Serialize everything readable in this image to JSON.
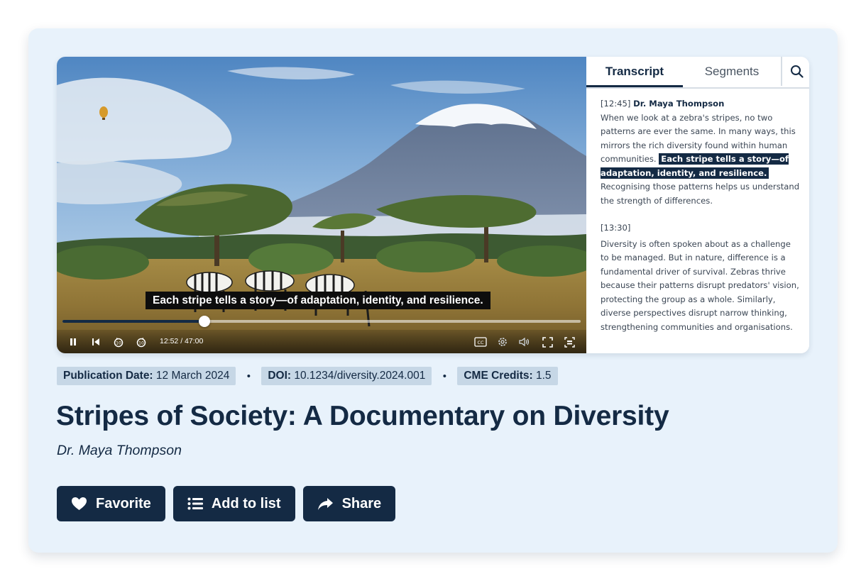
{
  "player": {
    "caption": "Each stripe tells a story—of adaptation, identity, and resilience.",
    "time": "12:52 / 47:00",
    "progress_fraction": 0.274,
    "controls": [
      "pause-icon",
      "skip-back-icon",
      "rewind-10-icon",
      "forward-10-icon",
      "closed-captions-icon",
      "settings-gear-icon",
      "volume-icon",
      "fullscreen-icon",
      "picture-in-picture-icon"
    ]
  },
  "sidebar": {
    "tabs": {
      "transcript": "Transcript",
      "segments": "Segments"
    },
    "search_icon": "search-icon",
    "entries": [
      {
        "timestamp": "[12:45]",
        "speaker": "Dr. Maya Thompson",
        "text_before": "When we look at a zebra's stripes, no two patterns are ever the same. In many ways, this mirrors the rich diversity found within human communities.",
        "highlight": "Each stripe tells a story—of adaptation, identity, and resilience.",
        "text_after": "Recognising those patterns helps us understand the strength of differences."
      },
      {
        "timestamp": "[13:30]",
        "text": "Diversity is often spoken about as a challenge to be managed. But in nature, difference is a fundamental driver of survival. Zebras thrive because their patterns disrupt predators' vision, protecting the group as a whole. Similarly, diverse perspectives disrupt narrow thinking, strengthening communities and organisations."
      }
    ]
  },
  "meta": {
    "publication_label": "Publication Date:",
    "publication_value": "12 March 2024",
    "doi_label": "DOI:",
    "doi_value": "10.1234/diversity.2024.001",
    "cme_label": "CME Credits:",
    "cme_value": "1.5",
    "separator": "•"
  },
  "title": "Stripes of Society: A Documentary on Diversity",
  "author": "Dr. Maya Thompson",
  "actions": {
    "favorite": "Favorite",
    "add_to_list": "Add to list",
    "share": "Share"
  },
  "colors": {
    "navy": "#142a44",
    "card_bg": "#e8f2fb",
    "tag_bg": "#c6d7e6"
  }
}
